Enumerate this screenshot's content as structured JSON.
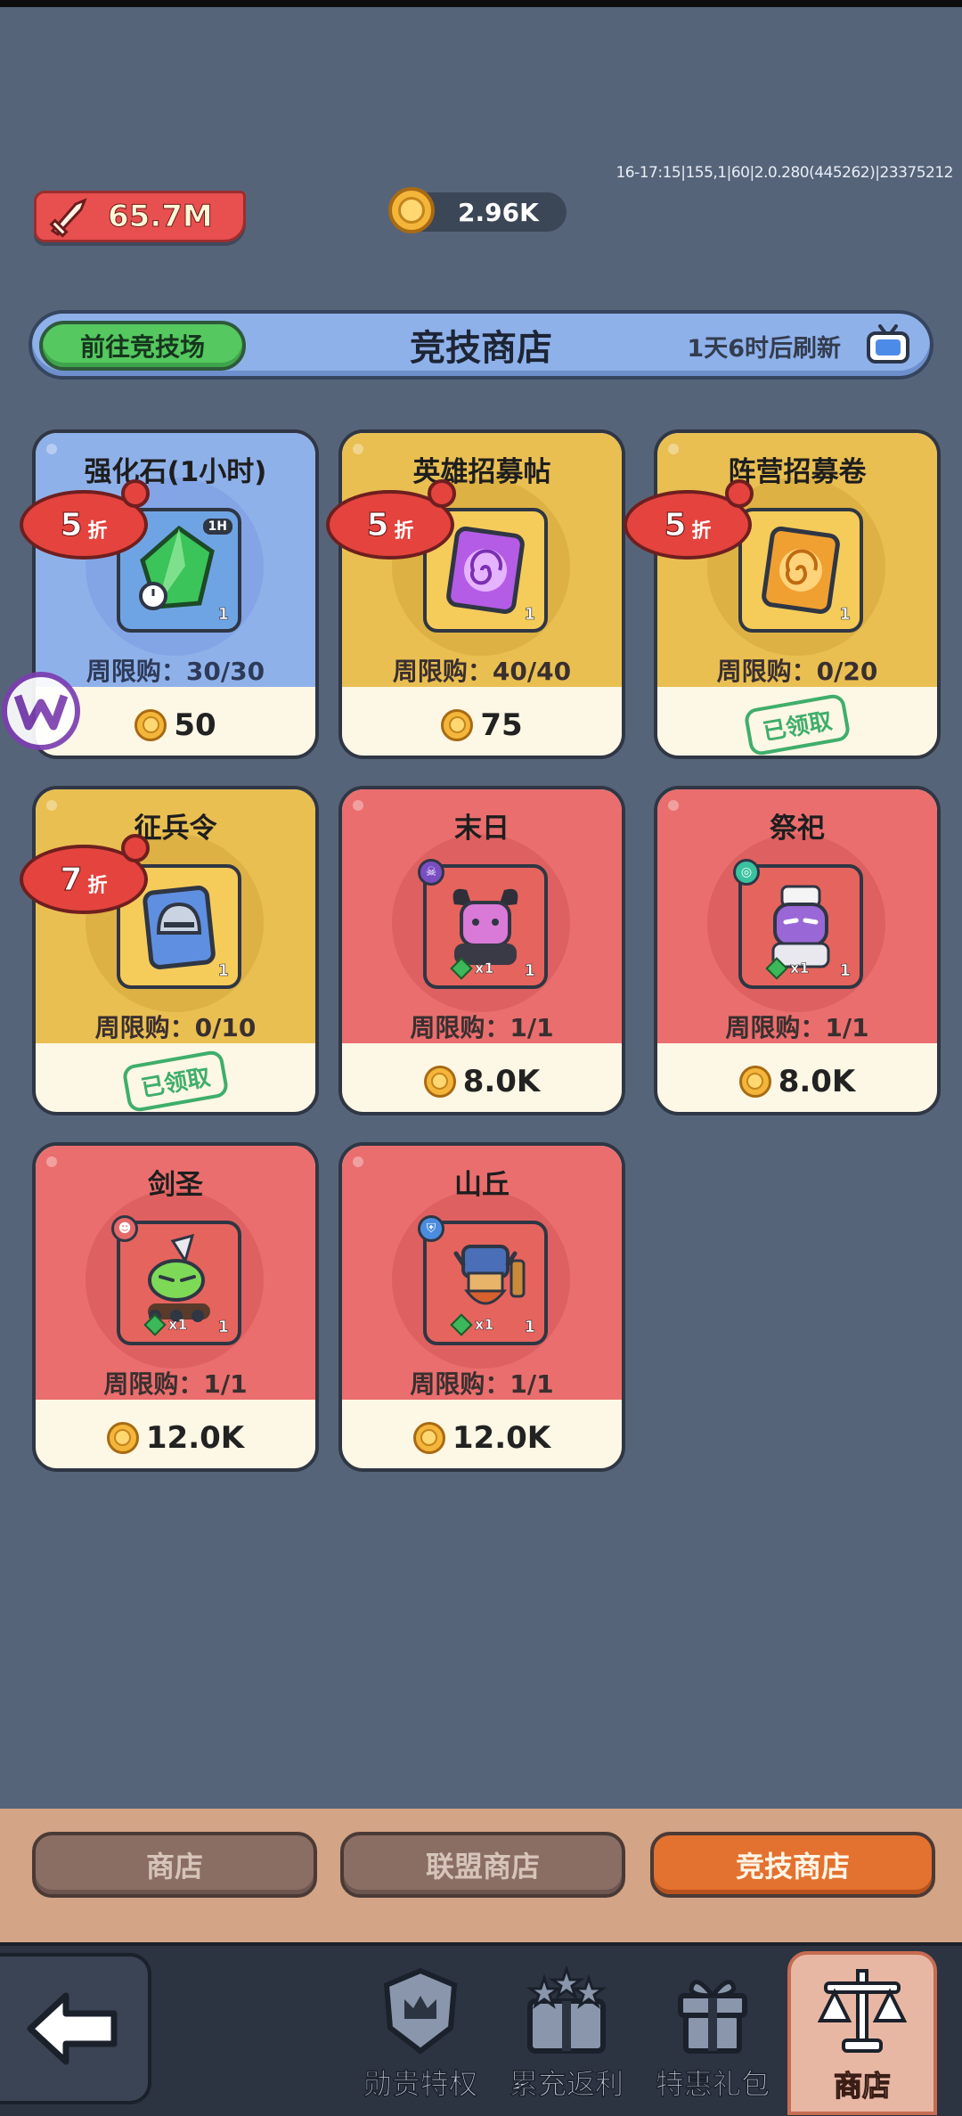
{
  "status": {
    "version": "16-17:15|155,1|60|2.0.280(445262)|23375212"
  },
  "resources": {
    "power": "65.7M",
    "coins": "2.96K"
  },
  "banner": {
    "goto_label": "前往竞技场",
    "title": "竞技商店",
    "refresh": "1天6时后刷新"
  },
  "cards": [
    {
      "name": "强化石(1小时)",
      "limit": "周限购：30/30",
      "price": "50",
      "discount_num": "5",
      "discount_unit": "折",
      "theme": "blue",
      "icon": "green-gem-icon",
      "tag": "1H",
      "qty": "1"
    },
    {
      "name": "英雄招募帖",
      "limit": "周限购：40/40",
      "price": "75",
      "discount_num": "5",
      "discount_unit": "折",
      "theme": "gold",
      "icon": "purple-scroll-icon",
      "qty": "1"
    },
    {
      "name": "阵营招募卷",
      "limit": "周限购：0/20",
      "claimed": "已领取",
      "discount_num": "5",
      "discount_unit": "折",
      "theme": "gold",
      "icon": "orange-scroll-icon",
      "qty": "1"
    },
    {
      "name": "征兵令",
      "limit": "周限购：0/10",
      "claimed": "已领取",
      "discount_num": "7",
      "discount_unit": "折",
      "theme": "gold",
      "icon": "helmet-card-icon",
      "qty": "1"
    },
    {
      "name": "末日",
      "limit": "周限购：1/1",
      "price": "8.0K",
      "theme": "red",
      "icon": "horned-demon-icon",
      "star": "x1",
      "qty": "1"
    },
    {
      "name": "祭祀",
      "limit": "周限购：1/1",
      "price": "8.0K",
      "theme": "red",
      "icon": "purple-priest-icon",
      "star": "x1",
      "qty": "1"
    },
    {
      "name": "剑圣",
      "limit": "周限购：1/1",
      "price": "12.0K",
      "theme": "red",
      "icon": "green-swordsman-icon",
      "star": "x1",
      "qty": "1"
    },
    {
      "name": "山丘",
      "limit": "周限购：1/1",
      "price": "12.0K",
      "theme": "red",
      "icon": "dwarf-warrior-icon",
      "star": "x1",
      "qty": "1"
    }
  ],
  "tabs": [
    {
      "label": "商店",
      "active": false
    },
    {
      "label": "联盟商店",
      "active": false
    },
    {
      "label": "竞技商店",
      "active": true
    }
  ],
  "nav": [
    {
      "label": "勋贵特权",
      "icon": "crown-shield-icon"
    },
    {
      "label": "累充返利",
      "icon": "stars-gift-icon"
    },
    {
      "label": "特惠礼包",
      "icon": "gift-box-icon"
    },
    {
      "label": "商店",
      "icon": "scale-icon",
      "active": true
    }
  ],
  "colors": {
    "background": "#566479",
    "accent_orange": "#e3712f",
    "card_red": "#ea6e6e",
    "card_gold": "#e9bf52",
    "card_blue": "#8fb1ea"
  }
}
